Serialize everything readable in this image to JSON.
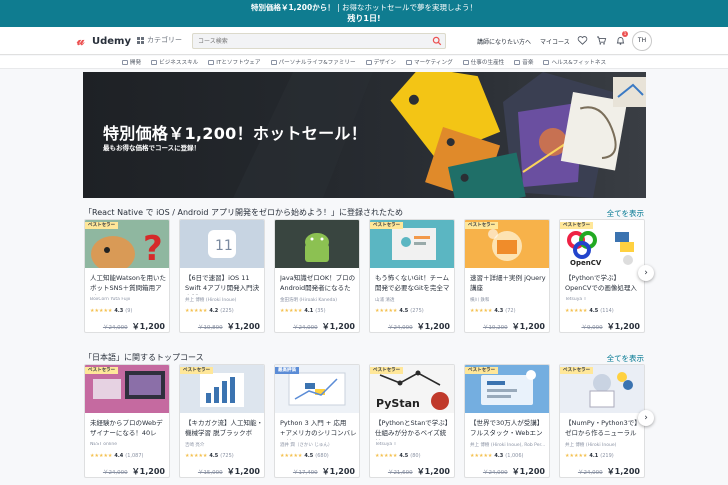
{
  "promo": {
    "bold_text": "特別価格￥1,200から！",
    "rest_text": "| お得なホットセールで夢を実現しよう！",
    "countdown": "残り1日!"
  },
  "header": {
    "logo_text": "Udemy",
    "categories_label": "カテゴリー",
    "search_placeholder": "コース検索",
    "instructor_link": "講師になりたい方へ",
    "my_courses_link": "マイコース",
    "notification_count": "1",
    "avatar_initials": "TH"
  },
  "category_nav": [
    {
      "label": "開発"
    },
    {
      "label": "ビジネススキル"
    },
    {
      "label": "ITとソフトウェア"
    },
    {
      "label": "パーソナルライフ&ファミリー"
    },
    {
      "label": "デザイン"
    },
    {
      "label": "マーケティング"
    },
    {
      "label": "仕事の生産性"
    },
    {
      "label": "音楽"
    },
    {
      "label": "ヘルス&フィットネス"
    }
  ],
  "hero": {
    "title": "特別価格￥1,200！ホットセール！",
    "subtitle": "最もお得な価格でコースに登録！"
  },
  "sections": [
    {
      "title": "「React Native で iOS / Android アプリ開発をゼロから始めよう！」に登録されたため",
      "see_all": "全てを表示",
      "courses": [
        {
          "badge": "ベストセラー",
          "title": "人工知能Watsonを用いたボットSNS＋質問箱用アプ...",
          "instructor": "BoxCorn Yuta Fujii",
          "rating": "4.3",
          "count": "(9)",
          "orig_price": "￥24,000",
          "price": "￥1,200",
          "thumb_color": "#e8a56a",
          "icon": "dog-question-thumbnail"
        },
        {
          "badge": "",
          "title": "【6日で速習】iOS 11 Swift 4アプリ開発入門決定版 2...",
          "instructor": "井上 博樹 (Hiroki Inoue)",
          "rating": "4.2",
          "count": "(225)",
          "orig_price": "￥10,800",
          "price": "￥1,200",
          "thumb_color": "#c9d6e4",
          "icon": "ios11-thumbnail"
        },
        {
          "badge": "",
          "title": "Java知識ゼロOK！プロのAndroid開発者になるため...",
          "instructor": "金田浩明 (Hiroaki Kaneda)",
          "rating": "4.1",
          "count": "(35)",
          "orig_price": "￥24,000",
          "price": "￥1,200",
          "thumb_color": "#3d4a42",
          "icon": "android-thumbnail"
        },
        {
          "badge": "ベストセラー",
          "title": "もう怖くないGit！チーム開発で必要なGitを完全マス...",
          "instructor": "山浦 清透",
          "rating": "4.5",
          "count": "(275)",
          "orig_price": "￥24,000",
          "price": "￥1,200",
          "thumb_color": "#57b4c0",
          "icon": "git-thumbnail"
        },
        {
          "badge": "ベストセラー",
          "title": "速習＋詳細＋実例 jQuery講座",
          "instructor": "横川 鉄和",
          "rating": "4.3",
          "count": "(72)",
          "orig_price": "￥10,200",
          "price": "￥1,200",
          "thumb_color": "#f0a040",
          "icon": "jquery-thumbnail"
        },
        {
          "badge": "ベストセラー",
          "title": "【Pythonで学ぶ】OpenCVでの画像処理入門",
          "instructor": "Tetsuya T",
          "rating": "4.5",
          "count": "(114)",
          "orig_price": "￥9,000",
          "price": "￥1,200",
          "thumb_color": "#ffffff",
          "icon": "opencv-thumbnail"
        }
      ]
    },
    {
      "title": "「日本語」に関するトップコース",
      "see_all": "全てを表示",
      "courses": [
        {
          "badge": "ベストセラー",
          "title": "未経験からプロのWebデザイナーになる！40レッ...",
          "instructor": "NEST online",
          "rating": "4.4",
          "count": "(1,087)",
          "orig_price": "￥24,000",
          "price": "￥1,200",
          "thumb_color": "#c86a9e",
          "icon": "web-designer-thumbnail"
        },
        {
          "badge": "ベストセラー",
          "title": "【キカガク流】人工知能・機械学習 脱ブラックボッ...",
          "instructor": "吉崎 亮介",
          "rating": "4.5",
          "count": "(725)",
          "orig_price": "￥15,000",
          "price": "￥1,200",
          "thumb_color": "#dde6ee",
          "icon": "ml-chart-thumbnail"
        },
        {
          "badge": "最高評価",
          "title": "Python 3 入門 + 応用 +アメリカのシリコンバレー流...",
          "instructor": "酒井 潤（さかい じゅん）",
          "rating": "4.5",
          "count": "(680)",
          "orig_price": "￥17,400",
          "price": "￥1,200",
          "thumb_color": "#eef2f7",
          "icon": "python-thumbnail"
        },
        {
          "badge": "ベストセラー",
          "title": "【PythonとStanで学ぶ】仕組みが分かるベイズ統計...",
          "instructor": "Tetsuya T",
          "rating": "4.5",
          "count": "(80)",
          "orig_price": "￥21,600",
          "price": "￥1,200",
          "thumb_color": "#f3f3f3",
          "icon": "pystan-thumbnail"
        },
        {
          "badge": "ベストセラー",
          "title": "【世界で30万人が受講】フルスタック・Webエンジ...",
          "instructor": "井上 博樹 (Hiroki Inoue), Rob Per...",
          "rating": "4.3",
          "count": "(1,006)",
          "orig_price": "￥24,000",
          "price": "￥1,200",
          "thumb_color": "#6fa8dc",
          "icon": "fullstack-thumbnail"
        },
        {
          "badge": "ベストセラー",
          "title": "【NumPy・Python3で】ゼロから作るニューラルネ...",
          "instructor": "井上 博樹 (Hiroki Inoue)",
          "rating": "4.1",
          "count": "(219)",
          "orig_price": "￥24,000",
          "price": "￥1,200",
          "thumb_color": "#e8edf4",
          "icon": "neural-net-thumbnail"
        }
      ]
    }
  ],
  "icons": {
    "search": "search-icon",
    "wishlist": "heart-icon",
    "cart": "cart-icon",
    "notification": "bell-icon",
    "next": "chevron-right-icon"
  },
  "colors": {
    "promo_bg": "#0f7c90",
    "brand_red": "#ec5252",
    "link": "#007791",
    "star": "#f4c150",
    "bestseller_badge": "#ffe799"
  }
}
